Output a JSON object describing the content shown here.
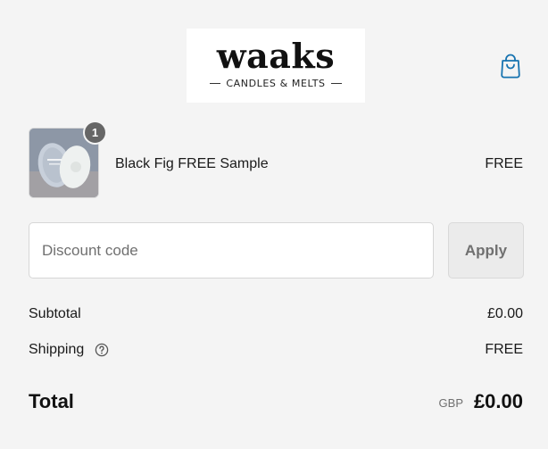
{
  "header": {
    "logo": {
      "wordmark": "waaks",
      "tagline": "CANDLES & MELTS"
    },
    "cart_icon": "shopping-bag-icon",
    "accent_color": "#1773b0"
  },
  "line_item": {
    "name": "Black Fig FREE Sample",
    "price": "FREE",
    "quantity": "1"
  },
  "discount": {
    "placeholder": "Discount code",
    "value": "",
    "apply_label": "Apply"
  },
  "summary": {
    "subtotal_label": "Subtotal",
    "subtotal_value": "£0.00",
    "shipping_label": "Shipping",
    "shipping_value": "FREE",
    "shipping_help_icon": "question-circle-icon",
    "total_label": "Total",
    "total_currency": "GBP",
    "total_value": "£0.00"
  }
}
